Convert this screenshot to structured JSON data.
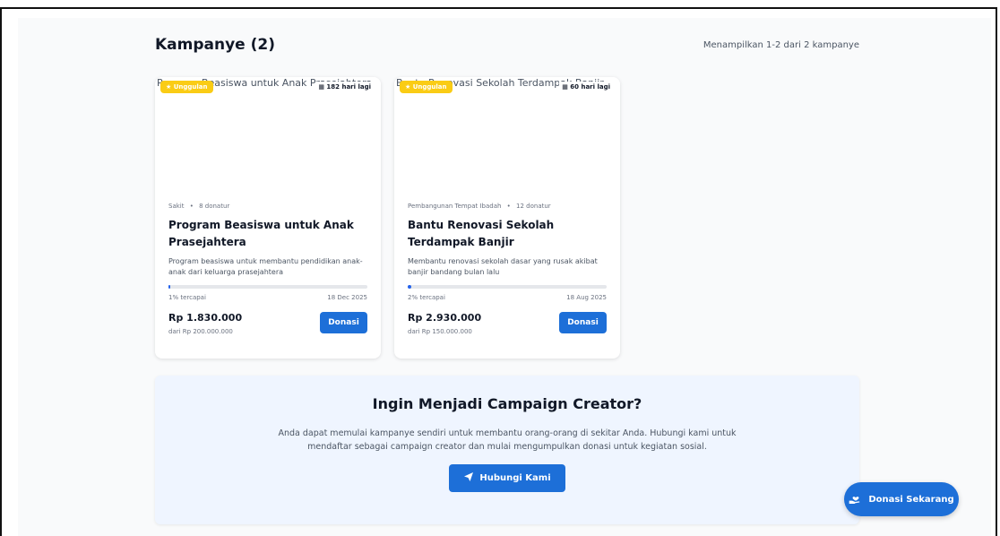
{
  "header": {
    "title": "Kampanye (2)",
    "showing": "Menampilkan 1-2 dari 2 kampanye"
  },
  "campaigns": [
    {
      "image_alt": "Program Beasiswa untuk Anak Prasejahtera",
      "featured_label": "Unggulan",
      "days_left": "182 hari lagi",
      "category": "Sakit",
      "donors": "8 donatur",
      "title": "Program Beasiswa untuk Anak Prasejahtera",
      "description": "Program beasiswa untuk membantu pendidikan anak-anak dari keluarga prasejahtera",
      "progress_percent": 1,
      "progress_text": "1% tercapai",
      "end_date": "18 Dec 2025",
      "amount": "Rp 1.830.000",
      "goal": "dari Rp 200.000.000",
      "donate_label": "Donasi"
    },
    {
      "image_alt": "Bantu Renovasi Sekolah Terdampak Banjir",
      "featured_label": "Unggulan",
      "days_left": "60 hari lagi",
      "category": "Pembangunan Tempat Ibadah",
      "donors": "12 donatur",
      "title": "Bantu Renovasi Sekolah Terdampak Banjir",
      "description": "Membantu renovasi sekolah dasar yang rusak akibat banjir bandang bulan lalu",
      "progress_percent": 2,
      "progress_text": "2% tercapai",
      "end_date": "18 Aug 2025",
      "amount": "Rp 2.930.000",
      "goal": "dari Rp 150.000.000",
      "donate_label": "Donasi"
    }
  ],
  "cta": {
    "title": "Ingin Menjadi Campaign Creator?",
    "description": "Anda dapat memulai kampanye sendiri untuk membantu orang-orang di sekitar Anda. Hubungi kami untuk mendaftar sebagai campaign creator dan mulai mengumpulkan donasi untuk kegiatan sosial.",
    "button_label": "Hubungi Kami",
    "button_icon": "paper-plane-icon"
  },
  "fab": {
    "label": "Donasi Sekarang",
    "icon": "hand-holding-heart-icon"
  },
  "colors": {
    "primary": "#1d6fd8",
    "featured": "#facc15",
    "cta_background": "#eff5ff"
  }
}
